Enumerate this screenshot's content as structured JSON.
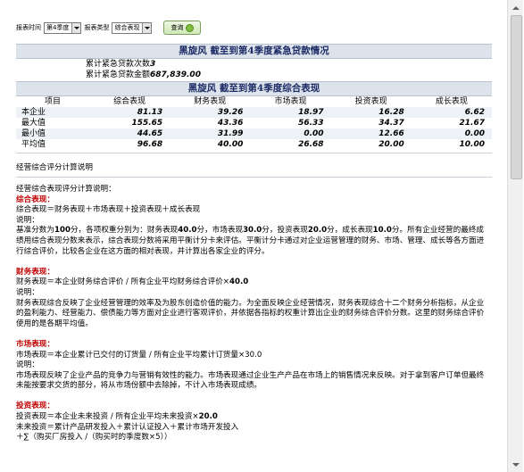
{
  "filters": {
    "period_label": "报表时间",
    "period_value": "第4季度",
    "type_label": "报表类型",
    "type_value": "综合表现",
    "query_button": "查询"
  },
  "loan": {
    "title": "黑旋风  截至到第4季度紧急贷款情况",
    "count_label": "累计紧急贷款次数",
    "count_value": "3",
    "amount_label": "累计紧急贷款金额",
    "amount_value": "687,839.00"
  },
  "perf": {
    "title": "黑旋风  截至到第4季度综合表现",
    "columns": [
      "项目",
      "综合表现",
      "财务表现",
      "市场表现",
      "投资表现",
      "成长表现"
    ],
    "rows": [
      {
        "label": "本企业",
        "values": [
          "81.13",
          "39.26",
          "18.97",
          "16.28",
          "6.62"
        ]
      },
      {
        "label": "最大值",
        "values": [
          "155.65",
          "43.36",
          "56.33",
          "34.37",
          "21.67"
        ]
      },
      {
        "label": "最小值",
        "values": [
          "44.65",
          "31.99",
          "0.00",
          "12.66",
          "0.00"
        ]
      },
      {
        "label": "平均值",
        "values": [
          "96.68",
          "40.00",
          "26.68",
          "20.00",
          "10.00"
        ]
      }
    ]
  },
  "explain": {
    "section_title": "经营综合评分计算说明",
    "intro": "经营综合表现评分计算说明：",
    "comp_title": "综合表现：",
    "comp_formula": "综合表现＝财务表现＋市场表现＋投资表现＋成长表现",
    "comp_note": "说明：",
    "comp_b1": "基准分数为",
    "comp_b2": "100",
    "comp_b3": "分，各项权重分别为：财务表现",
    "comp_b4": "40.0",
    "comp_b5": "分，市场表现",
    "comp_b6": "30.0",
    "comp_b7": "分，投资表现",
    "comp_b8": "20.0",
    "comp_b9": "分，成长表现",
    "comp_b10": "10.0",
    "comp_b11": "分。所有企业经营的最终成绩用综合表现分数来表示，综合表现分数将采用平衡计分卡来评估。平衡计分卡通过对企业运营管理的财务、市场、管理、成长等各方面进行综合评价，比较各企业在这方面的相对表现，并计算出各家企业的评分。",
    "fin_title": "财务表现：",
    "fin_formula_a": "财务表现＝本企业财务综合评价 / 所有企业平均财务综合评价×",
    "fin_formula_b": "40.0",
    "fin_note": "说明：",
    "fin_desc": "财务表现综合反映了企业经营管理的效率及为股东创造价值的能力。为全面反映企业经营情况，财务表现综合十二个财务分析指标，从企业的盈利能力、经营能力、偿债能力等方面对企业进行客观评价，并依据各指标的权重计算出企业的财务综合评价分数。这里的财务综合评价使用的是各期平均值。",
    "mkt_title": "市场表现：",
    "mkt_formula": "市场表现＝本企业累计已交付的订货量 / 所有企业平均累计订货量×30.0",
    "mkt_note": "说明：",
    "mkt_desc": "市场表现反映了企业产品的竞争力与营销有效性的能力。市场表现通过企业生产产品在市场上的销售情况来反映。对于拿到客户订单但最终未能按要求交货的部分，将从市场份额中去除掉，不计入市场表现成绩。",
    "inv_title": "投资表现：",
    "inv_formula_a": "投资表现＝本企业未来投资 / 所有企业平均未来投资×",
    "inv_formula_b": "20.0",
    "inv_line2": "未来投资＝累计产品研发投入＋累计认证投入＋累计市场开发投入",
    "inv_line3": "＋∑（购买厂房投入 /（购买时的季度数×5））"
  }
}
